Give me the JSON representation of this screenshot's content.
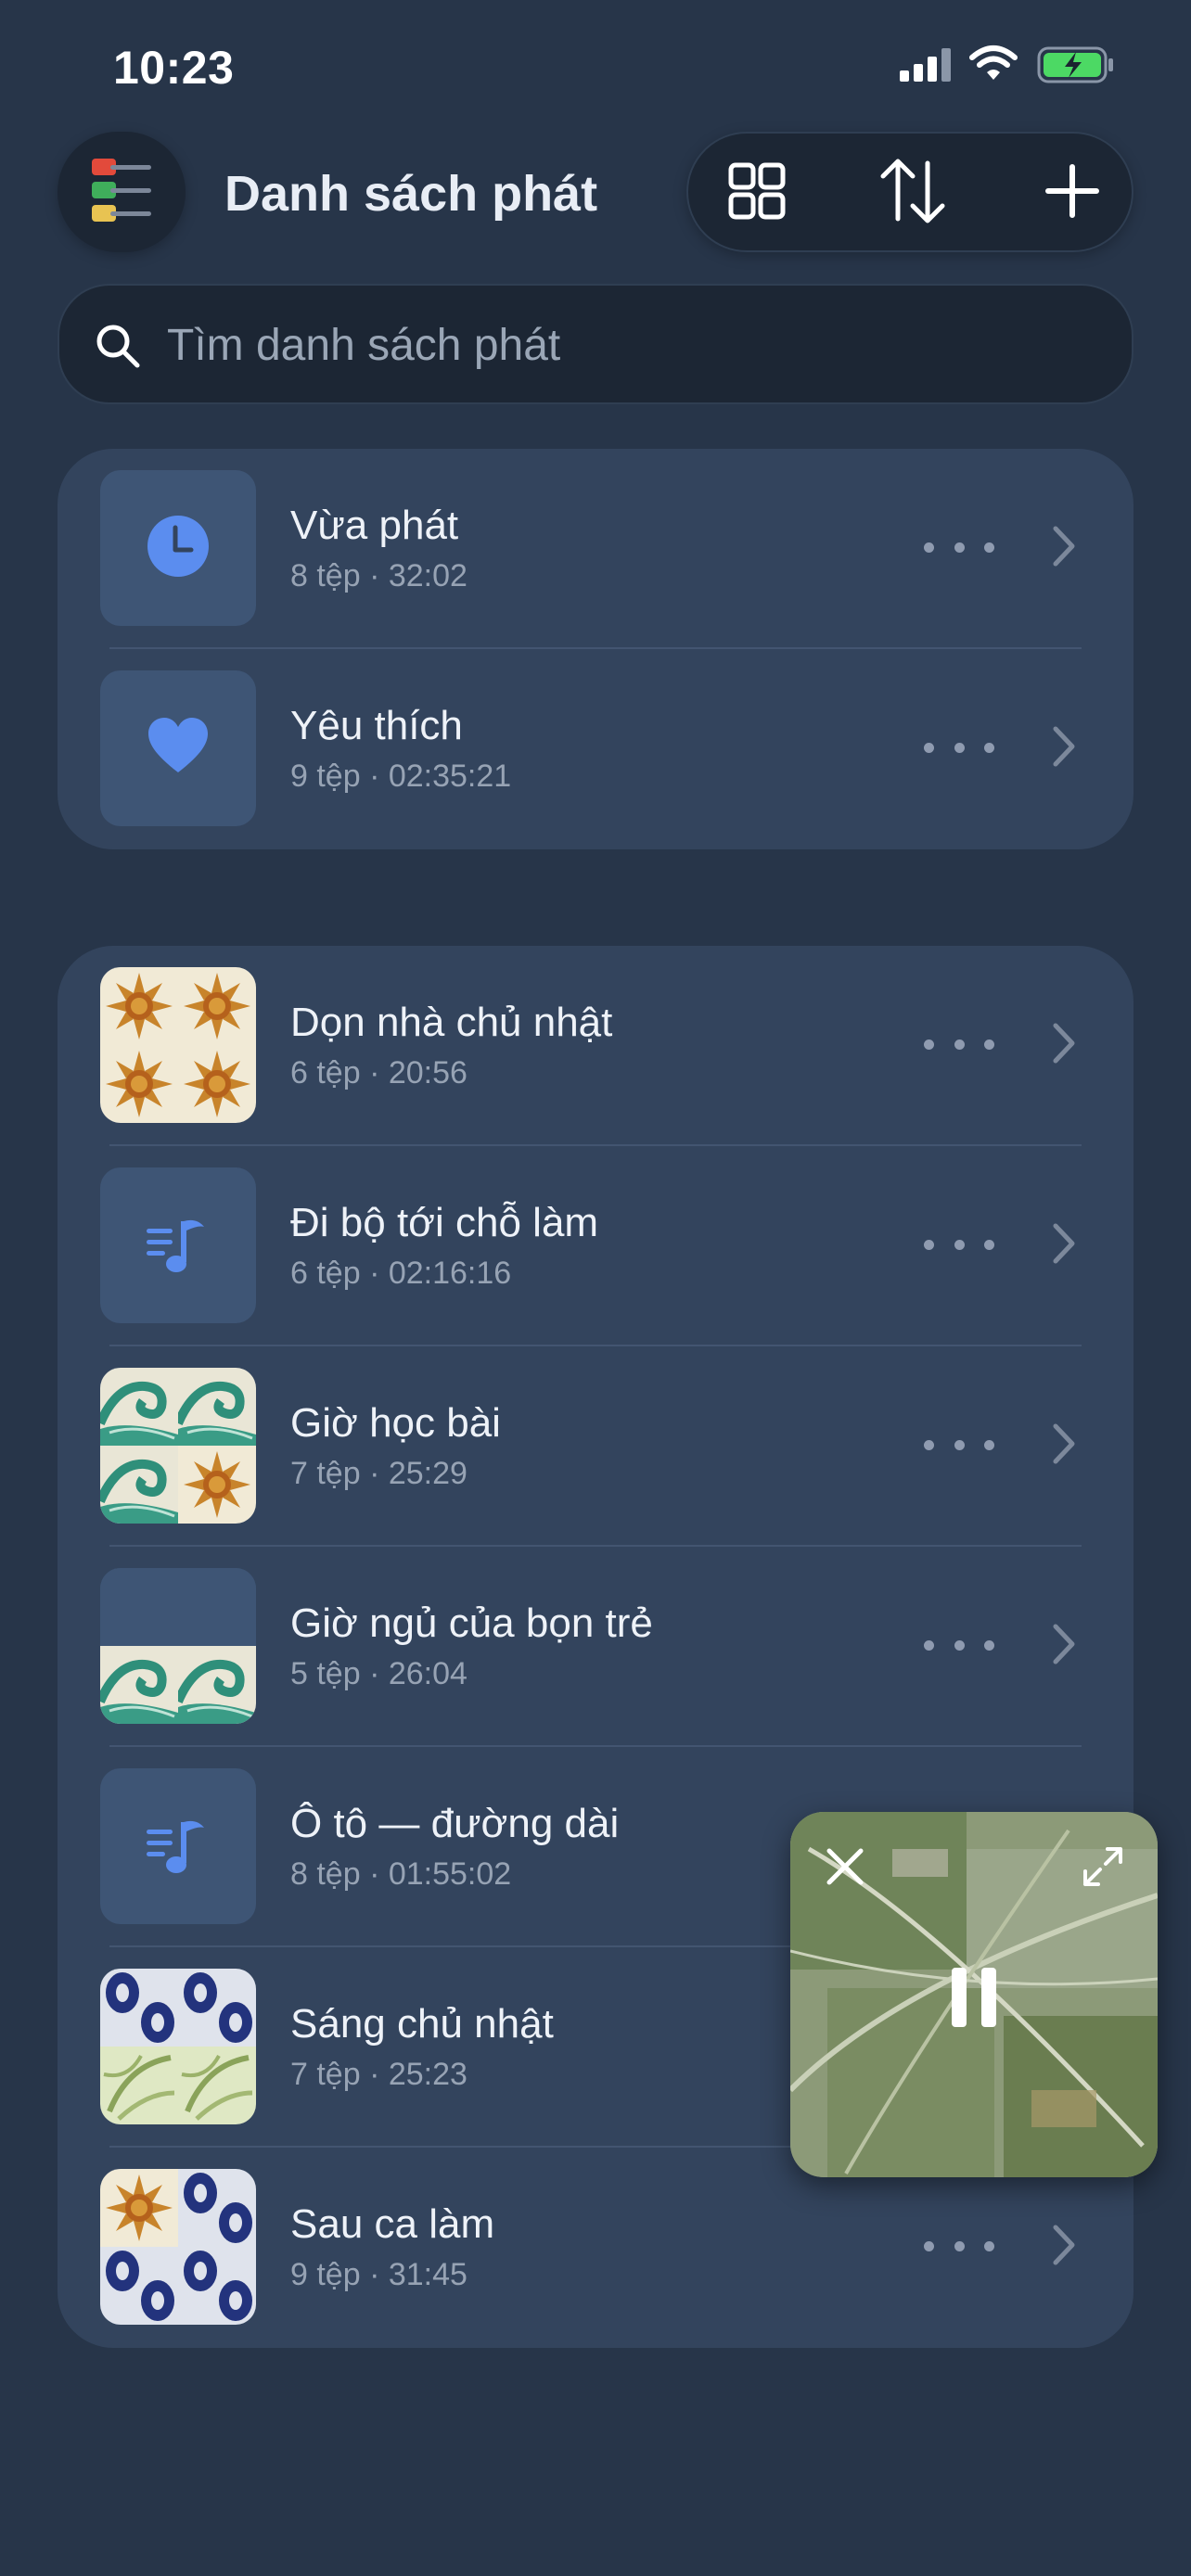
{
  "status_bar": {
    "time": "10:23"
  },
  "header": {
    "title": "Danh sách phát"
  },
  "toolbar": {
    "grid_icon": "grid-icon",
    "sort_icon": "sort-icon",
    "add_icon": "plus-icon"
  },
  "search": {
    "placeholder": "Tìm danh sách phát",
    "value": ""
  },
  "pinned": [
    {
      "title": "Vừa phát",
      "meta": "8 tệp · 32:02",
      "icon": "clock-icon"
    },
    {
      "title": "Yêu thích",
      "meta": "9 tệp · 02:35:21",
      "icon": "heart-icon"
    }
  ],
  "playlists": [
    {
      "title": "Dọn nhà chủ nhật",
      "meta": "6 tệp · 20:56",
      "art": [
        "sun",
        "sun",
        "sun",
        "sun"
      ]
    },
    {
      "title": "Đi bộ tới chỗ làm",
      "meta": "6 tệp · 02:16:16",
      "art": "music-note-icon"
    },
    {
      "title": "Giờ học bài",
      "meta": "7 tệp · 25:29",
      "art": [
        "wave",
        "wave",
        "wave",
        "sun"
      ]
    },
    {
      "title": "Giờ ngủ của bọn trẻ",
      "meta": "5 tệp · 26:04",
      "art": [
        "blank",
        "blank",
        "wave",
        "wave"
      ]
    },
    {
      "title": "Ô tô — đường dài",
      "meta": "8 tệp · 01:55:02",
      "art": "music-note-icon"
    },
    {
      "title": "Sáng chủ nhật",
      "meta": "7 tệp · 25:23",
      "art": [
        "blue",
        "blue",
        "leaf",
        "leaf"
      ]
    },
    {
      "title": "Sau ca làm",
      "meta": "9 tệp · 31:45",
      "art": [
        "sun",
        "blue",
        "blue",
        "blue"
      ]
    }
  ],
  "mini_player": {
    "state": "playing",
    "icons": [
      "close-icon",
      "expand-icon",
      "pause-icon"
    ]
  },
  "colors": {
    "background": "#273549",
    "card": "#33445d",
    "accent": "#5b8def",
    "text_muted": "#97a3b4"
  }
}
